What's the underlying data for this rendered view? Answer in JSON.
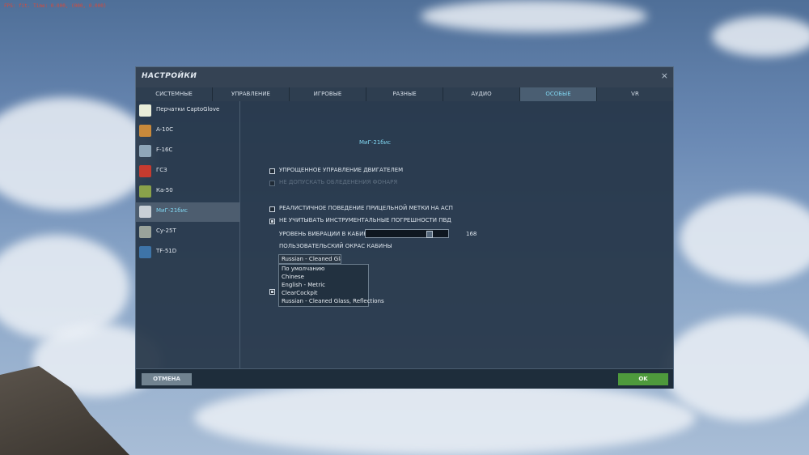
{
  "hud": {
    "fps": "FPS:   fit. Time: 0.000, (000, 0.000)"
  },
  "dialog": {
    "title": "НАСТРОЙКИ",
    "close_glyph": "×",
    "tabs": [
      "СИСТЕМНЫЕ",
      "УПРАВЛЕНИЕ",
      "ИГРОВЫЕ",
      "РАЗНЫЕ",
      "АУДИО",
      "ОСОБЫЕ",
      "VR"
    ],
    "active_tab": "ОСОБЫЕ",
    "sidebar": [
      {
        "label": "Перчатки CaptoGlove",
        "icon": "glove-icon",
        "color": "#e9edd9"
      },
      {
        "label": "A-10C",
        "icon": "a10c-aircraft-icon",
        "color": "#c98a3b"
      },
      {
        "label": "F-16C",
        "icon": "f16c-aircraft-icon",
        "color": "#8fa6b8"
      },
      {
        "label": "ГСЗ",
        "icon": "gsz-star-icon",
        "color": "#c63b2f"
      },
      {
        "label": "Ка-50",
        "icon": "ka50-helicopter-icon",
        "color": "#8aa24a"
      },
      {
        "label": "МиГ-21бис",
        "icon": "mig21-aircraft-icon",
        "color": "#c9d0d6",
        "active": true
      },
      {
        "label": "Су-25Т",
        "icon": "su25t-aircraft-icon",
        "color": "#9aa39b"
      },
      {
        "label": "TF-51D",
        "icon": "tf51d-aircraft-icon",
        "color": "#3e74a8"
      }
    ],
    "module_title": "МиГ-21бис",
    "options": {
      "simplified_engine": {
        "label": "УПРОЩЕННОЕ УПРАВЛЕНИЕ ДВИГАТЕЛЕМ",
        "checked": false
      },
      "no_canopy_icing": {
        "label": "НЕ ДОПУСКАТЬ ОБЛЕДЕНЕНИЯ ФОНАРЯ",
        "checked": false,
        "disabled": true
      },
      "realistic_pipper": {
        "label": "РЕАЛИСТИЧНОЕ ПОВЕДЕНИЕ ПРИЦЕЛЬНОЙ МЕТКИ НА АСП",
        "checked": false
      },
      "ignore_pvd_errors": {
        "label": "НЕ УЧИТЫВАТЬ ИНСТРУМЕНТАЛЬНЫЕ ПОГРЕШНОСТИ ПВД",
        "checked": true
      },
      "vibration": {
        "label": "УРОВЕНЬ ВИБРАЦИИ В КАБИНЕ",
        "value": "168",
        "fraction": 0.78
      },
      "cockpit_livery": {
        "label": "ПОЛЬЗОВАТЕЛЬСКИЙ ОКРАС КАБИНЫ",
        "selected": "Russian - Cleaned Glass, Reflections",
        "options": [
          "По умолчанию",
          "Chinese",
          "English - Metric",
          "ClearCockpit",
          "Russian - Cleaned Glass, Reflections"
        ]
      },
      "hidden_checkbox_checked": true
    },
    "buttons": {
      "cancel": "ОТМЕНА",
      "ok": "OK"
    }
  }
}
